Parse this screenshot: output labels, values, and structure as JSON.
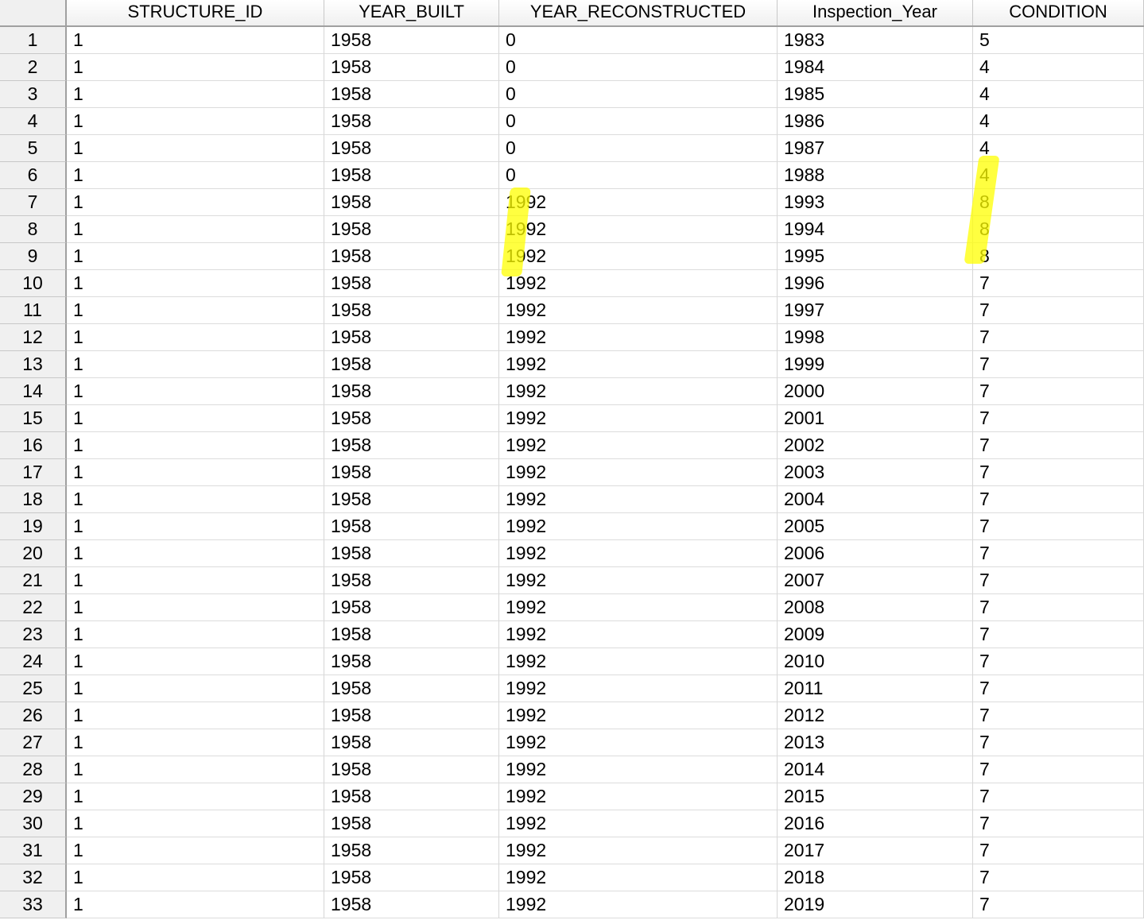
{
  "columns": [
    "",
    "STRUCTURE_ID",
    "YEAR_BUILT",
    "YEAR_RECONSTRUCTED",
    "Inspection_Year",
    "CONDITION"
  ],
  "rows": [
    [
      "1",
      "1",
      "1958",
      "0",
      "1983",
      "5"
    ],
    [
      "2",
      "1",
      "1958",
      "0",
      "1984",
      "4"
    ],
    [
      "3",
      "1",
      "1958",
      "0",
      "1985",
      "4"
    ],
    [
      "4",
      "1",
      "1958",
      "0",
      "1986",
      "4"
    ],
    [
      "5",
      "1",
      "1958",
      "0",
      "1987",
      "4"
    ],
    [
      "6",
      "1",
      "1958",
      "0",
      "1988",
      "4"
    ],
    [
      "7",
      "1",
      "1958",
      "1992",
      "1993",
      "8"
    ],
    [
      "8",
      "1",
      "1958",
      "1992",
      "1994",
      "8"
    ],
    [
      "9",
      "1",
      "1958",
      "1992",
      "1995",
      "8"
    ],
    [
      "10",
      "1",
      "1958",
      "1992",
      "1996",
      "7"
    ],
    [
      "11",
      "1",
      "1958",
      "1992",
      "1997",
      "7"
    ],
    [
      "12",
      "1",
      "1958",
      "1992",
      "1998",
      "7"
    ],
    [
      "13",
      "1",
      "1958",
      "1992",
      "1999",
      "7"
    ],
    [
      "14",
      "1",
      "1958",
      "1992",
      "2000",
      "7"
    ],
    [
      "15",
      "1",
      "1958",
      "1992",
      "2001",
      "7"
    ],
    [
      "16",
      "1",
      "1958",
      "1992",
      "2002",
      "7"
    ],
    [
      "17",
      "1",
      "1958",
      "1992",
      "2003",
      "7"
    ],
    [
      "18",
      "1",
      "1958",
      "1992",
      "2004",
      "7"
    ],
    [
      "19",
      "1",
      "1958",
      "1992",
      "2005",
      "7"
    ],
    [
      "20",
      "1",
      "1958",
      "1992",
      "2006",
      "7"
    ],
    [
      "21",
      "1",
      "1958",
      "1992",
      "2007",
      "7"
    ],
    [
      "22",
      "1",
      "1958",
      "1992",
      "2008",
      "7"
    ],
    [
      "23",
      "1",
      "1958",
      "1992",
      "2009",
      "7"
    ],
    [
      "24",
      "1",
      "1958",
      "1992",
      "2010",
      "7"
    ],
    [
      "25",
      "1",
      "1958",
      "1992",
      "2011",
      "7"
    ],
    [
      "26",
      "1",
      "1958",
      "1992",
      "2012",
      "7"
    ],
    [
      "27",
      "1",
      "1958",
      "1992",
      "2013",
      "7"
    ],
    [
      "28",
      "1",
      "1958",
      "1992",
      "2014",
      "7"
    ],
    [
      "29",
      "1",
      "1958",
      "1992",
      "2015",
      "7"
    ],
    [
      "30",
      "1",
      "1958",
      "1992",
      "2016",
      "7"
    ],
    [
      "31",
      "1",
      "1958",
      "1992",
      "2017",
      "7"
    ],
    [
      "32",
      "1",
      "1958",
      "1992",
      "2018",
      "7"
    ],
    [
      "33",
      "1",
      "1958",
      "1992",
      "2019",
      "7"
    ]
  ],
  "highlight_color": "#ffff00",
  "highlighted_rows": {
    "YEAR_RECONSTRUCTED": [
      "7",
      "8",
      "9"
    ],
    "CONDITION": [
      "6",
      "7",
      "8",
      "9"
    ]
  }
}
